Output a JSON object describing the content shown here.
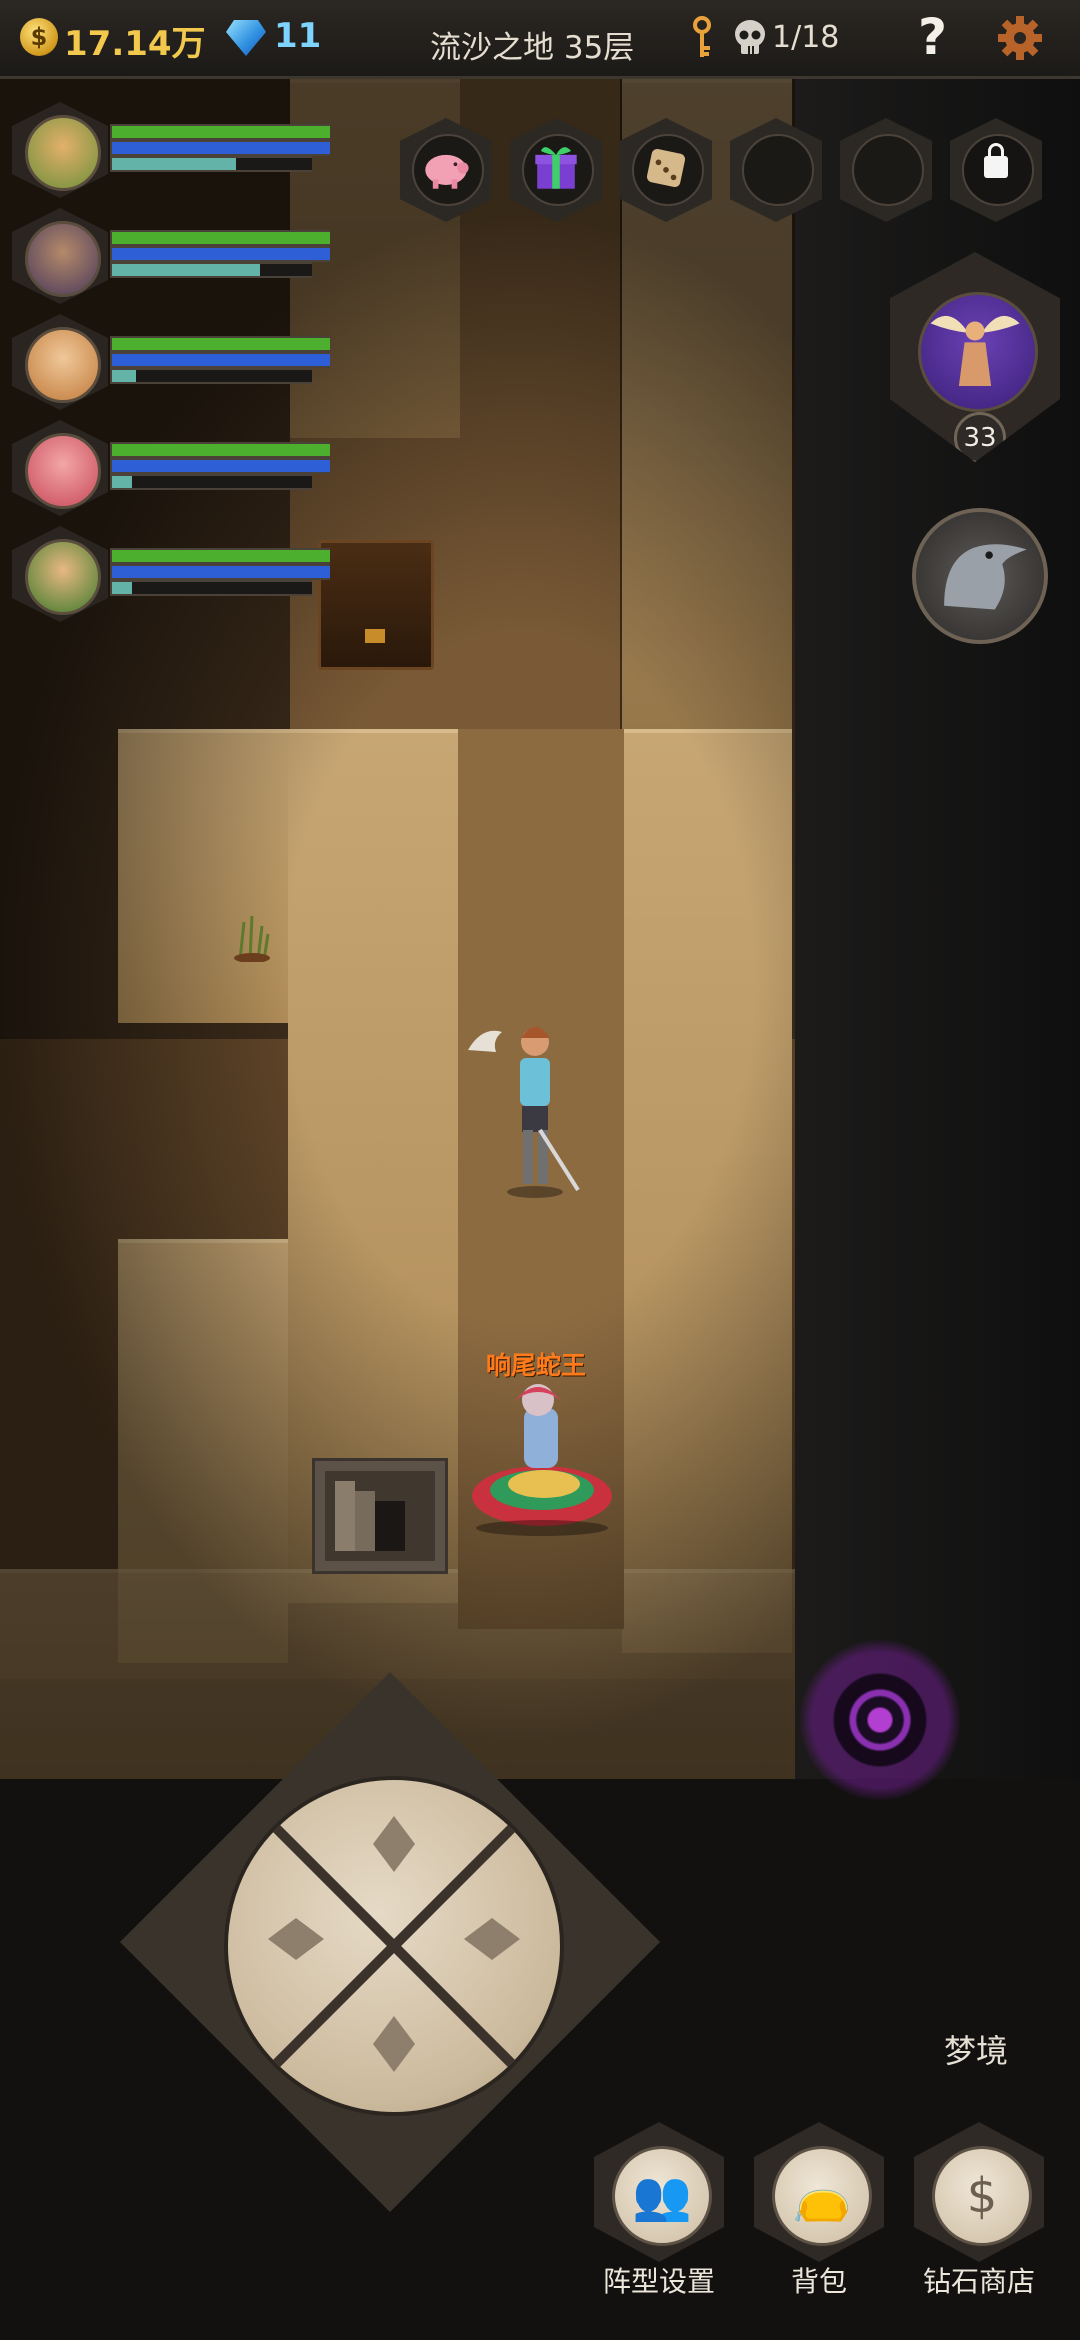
{
  "topbar": {
    "gold": "17.14万",
    "gold_icon": "$",
    "gems": "11",
    "floor_title": "流沙之地 35层",
    "kill_count": "1/18",
    "help_label": "?"
  },
  "heroes": [
    {
      "hp": 1.0,
      "mp": 1.0,
      "xp": 0.62,
      "portrait_color": "#6d8f3a"
    },
    {
      "hp": 1.0,
      "mp": 1.0,
      "xp": 0.74,
      "portrait_color": "#4a3a5a"
    },
    {
      "hp": 1.0,
      "mp": 1.0,
      "xp": 0.12,
      "portrait_color": "#c07a3a"
    },
    {
      "hp": 1.0,
      "mp": 1.0,
      "xp": 0.1,
      "portrait_color": "#c74a5a"
    },
    {
      "hp": 1.0,
      "mp": 1.0,
      "xp": 0.1,
      "portrait_color": "#3f7a2a"
    }
  ],
  "item_slots": [
    {
      "icon": "piggy-bank-icon",
      "state": "filled"
    },
    {
      "icon": "gift-box-icon",
      "state": "filled"
    },
    {
      "icon": "dice-icon",
      "state": "filled"
    },
    {
      "icon": "empty-slot",
      "state": "empty"
    },
    {
      "icon": "empty-slot",
      "state": "empty"
    },
    {
      "icon": "lock-icon",
      "state": "locked"
    }
  ],
  "pets": {
    "angel_level": "33"
  },
  "map": {
    "boss_name": "响尾蛇王"
  },
  "bottom": {
    "dream_label": "梦境",
    "formation_label": "阵型设置",
    "formation_icon": "👥",
    "bag_label": "背包",
    "bag_icon": "👝",
    "shop_label": "钻石商店",
    "shop_icon": "$"
  },
  "colors": {
    "hp_bar": "#4caf2e",
    "mp_bar": "#2f5fd6",
    "xp_bar": "#63b3a8",
    "boss_name": "#ff7a1a",
    "gold_text": "#f2c94c",
    "gem_text": "#7fd3ff"
  }
}
